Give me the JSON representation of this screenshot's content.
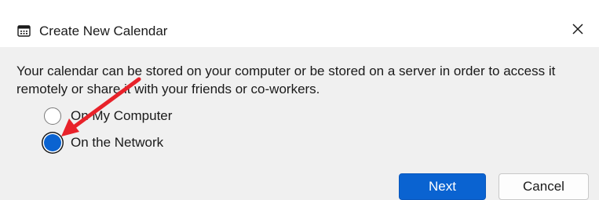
{
  "dialog": {
    "title": "Create New Calendar",
    "close_icon": "close-icon",
    "title_icon": "calendar-icon"
  },
  "main": {
    "description": "Your calendar can be stored on your computer or be stored on a server in order to access it remotely or share it with your friends or co-workers.",
    "options": [
      {
        "label": "On My Computer",
        "selected": false
      },
      {
        "label": "On the Network",
        "selected": true
      }
    ]
  },
  "buttons": {
    "next_label": "Next",
    "cancel_label": "Cancel"
  },
  "annotation": {
    "arrow_color": "#e8222a",
    "accent_color": "#0a63d1"
  }
}
